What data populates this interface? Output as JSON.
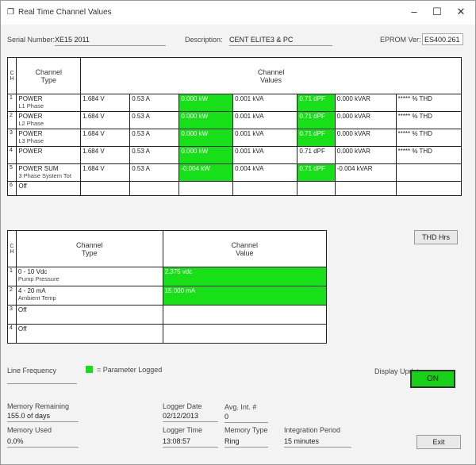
{
  "title": "Real Time Channel Values",
  "header": {
    "serial_label": "Serial Number:",
    "serial_value": "XE15 2011",
    "description_label": "Description:",
    "description_value": "CENT ELITE3 & PC",
    "eprom_label": "EPROM Ver:",
    "eprom_value": "ES400.261"
  },
  "table1": {
    "col_ch": "C\nH",
    "col_type": "Channel\nType",
    "col_values": "Channel\nValues",
    "rows": [
      {
        "ch": "1",
        "type": "POWER",
        "sub": "L1 Phase",
        "v": "1.684 V",
        "a": "0.53 A",
        "w": "0.000 kW",
        "va": "0.001 kVA",
        "pf": "0.71 dPF",
        "var": "0.000 kVAR",
        "thd": "***** % THD",
        "w_g": true,
        "pf_g": true
      },
      {
        "ch": "2",
        "type": "POWER",
        "sub": "L2 Phase",
        "v": "1.684 V",
        "a": "0.53 A",
        "w": "0.000 kW",
        "va": "0.001 kVA",
        "pf": "0.71 dPF",
        "var": "0.000 kVAR",
        "thd": "***** % THD",
        "w_g": true,
        "pf_g": true
      },
      {
        "ch": "3",
        "type": "POWER",
        "sub": "L3 Phase",
        "v": "1.684 V",
        "a": "0.53 A",
        "w": "0.000 kW",
        "va": "0.001 kVA",
        "pf": "0.71 dPF",
        "var": "0.000 kVAR",
        "thd": "***** % THD",
        "w_g": true,
        "pf_g": true
      },
      {
        "ch": "4",
        "type": "POWER",
        "sub": "",
        "v": "1.684 V",
        "a": "0.53 A",
        "w": "0.000 kW",
        "va": "0.001 kVA",
        "pf": "0.71 dPF",
        "var": "0.000 kVAR",
        "thd": "***** % THD",
        "w_g": true,
        "pf_g": false
      },
      {
        "ch": "5",
        "type": "POWER SUM",
        "sub": "3 Phase System Tot",
        "v": "1.684 V",
        "a": "0.53 A",
        "w": "-0.004 kW",
        "va": "0.004 kVA",
        "pf": "0.71 dPF",
        "var": "-0.004 kVAR",
        "thd": "",
        "w_g": true,
        "pf_g": true
      },
      {
        "ch": "6",
        "type": "Off",
        "sub": "",
        "v": "",
        "a": "",
        "w": "",
        "va": "",
        "pf": "",
        "var": "",
        "thd": "",
        "w_g": false,
        "pf_g": false
      }
    ]
  },
  "thd_button": "THD Hrs",
  "table2": {
    "col_ch": "C\nH",
    "col_type": "Channel\nType",
    "col_value": "Channel\nValue",
    "rows": [
      {
        "ch": "1",
        "type": "0 - 10 Vdc",
        "sub": "Pump Pressure",
        "value": "2.375 vdc",
        "g": true
      },
      {
        "ch": "2",
        "type": "4 - 20 mA",
        "sub": "Ambient Temp",
        "value": "15.000 mA",
        "g": true
      },
      {
        "ch": "3",
        "type": "Off",
        "sub": "",
        "value": "",
        "g": false
      },
      {
        "ch": "4",
        "type": "Off",
        "sub": "",
        "value": "",
        "g": false
      }
    ]
  },
  "line_frequency_label": "Line Frequency",
  "legend_label": "= Parameter Logged",
  "display_update_label": "Display Update",
  "on_button": "ON",
  "memory_remaining_label": "Memory Remaining",
  "memory_remaining_value": "155.0 of days",
  "logger_date_label": "Logger Date",
  "logger_date_value": "02/12/2013",
  "avg_int_label": "Avg. Int. #",
  "avg_int_value": "0",
  "memory_used_label": "Memory Used",
  "memory_used_value": "0.0%",
  "logger_time_label": "Logger Time",
  "logger_time_value": "13:08:57",
  "memory_type_label": "Memory Type",
  "memory_type_value": "Ring",
  "integration_label": "Integration Period",
  "integration_value": "15 minutes",
  "exit_button": "Exit"
}
